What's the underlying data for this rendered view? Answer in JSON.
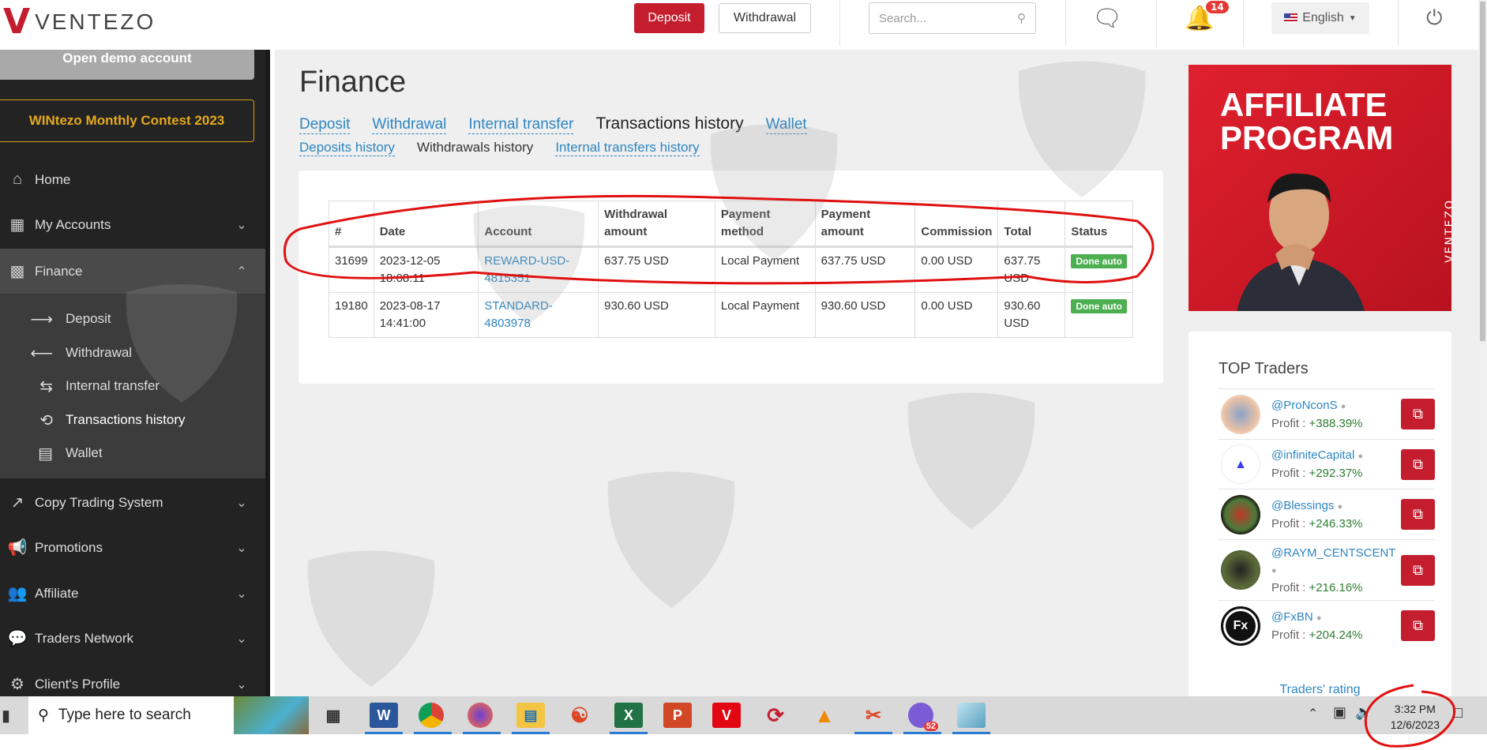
{
  "header": {
    "brand": "VENTEZO",
    "deposit": "Deposit",
    "withdrawal": "Withdrawal",
    "search_placeholder": "Search...",
    "notifications": "14",
    "language": "English"
  },
  "sidebar": {
    "demo": "Open demo account",
    "contest": "WINtezo Monthly Contest 2023",
    "items": [
      {
        "label": "Home"
      },
      {
        "label": "My Accounts"
      },
      {
        "label": "Finance"
      },
      {
        "label": "Copy Trading System"
      },
      {
        "label": "Promotions"
      },
      {
        "label": "Affiliate"
      },
      {
        "label": "Traders Network"
      },
      {
        "label": "Client's Profile"
      }
    ],
    "finance_sub": [
      {
        "label": "Deposit"
      },
      {
        "label": "Withdrawal"
      },
      {
        "label": "Internal transfer"
      },
      {
        "label": "Transactions history"
      },
      {
        "label": "Wallet"
      }
    ]
  },
  "main": {
    "title": "Finance",
    "tabs": [
      "Deposit",
      "Withdrawal",
      "Internal transfer",
      "Transactions history",
      "Wallet"
    ],
    "subtabs": [
      "Deposits history",
      "Withdrawals history",
      "Internal transfers history"
    ],
    "columns": [
      "#",
      "Date",
      "Account",
      "Withdrawal amount",
      "Payment method",
      "Payment amount",
      "Commission",
      "Total",
      "Status"
    ],
    "rows": [
      {
        "id": "31699",
        "date": "2023-12-05 18:08:11",
        "account": "REWARD-USD-4815351",
        "amount": "637.75 USD",
        "method": "Local Payment",
        "payment": "637.75 USD",
        "commission": "0.00 USD",
        "total": "637.75 USD",
        "status": "Done auto"
      },
      {
        "id": "19180",
        "date": "2023-08-17 14:41:00",
        "account": "STANDARD-4803978",
        "amount": "930.60 USD",
        "method": "Local Payment",
        "payment": "930.60 USD",
        "commission": "0.00 USD",
        "total": "930.60 USD",
        "status": "Done auto"
      }
    ]
  },
  "banner": {
    "title": "AFFILIATE PROGRAM",
    "brand": "VENTEZO"
  },
  "traders": {
    "title": "TOP Traders",
    "profit_label": "Profit :",
    "rating_link": "Traders' rating",
    "list": [
      {
        "name": "@ProNconS",
        "profit": "+388.39%"
      },
      {
        "name": "@infiniteCapital",
        "profit": "+292.37%"
      },
      {
        "name": "@Blessings",
        "profit": "+246.33%"
      },
      {
        "name": "@RAYM_CENTSCENT",
        "profit": "+216.16%"
      },
      {
        "name": "@FxBN",
        "profit": "+204.24%"
      }
    ]
  },
  "taskbar": {
    "search": "Type here to search",
    "time": "3:32 PM",
    "date": "12/6/2023",
    "chat_badge": "52"
  },
  "colors": {
    "brand": "#c41e2e",
    "link": "#2e86c1",
    "success": "#4caf50",
    "sidebar": "#232323"
  }
}
